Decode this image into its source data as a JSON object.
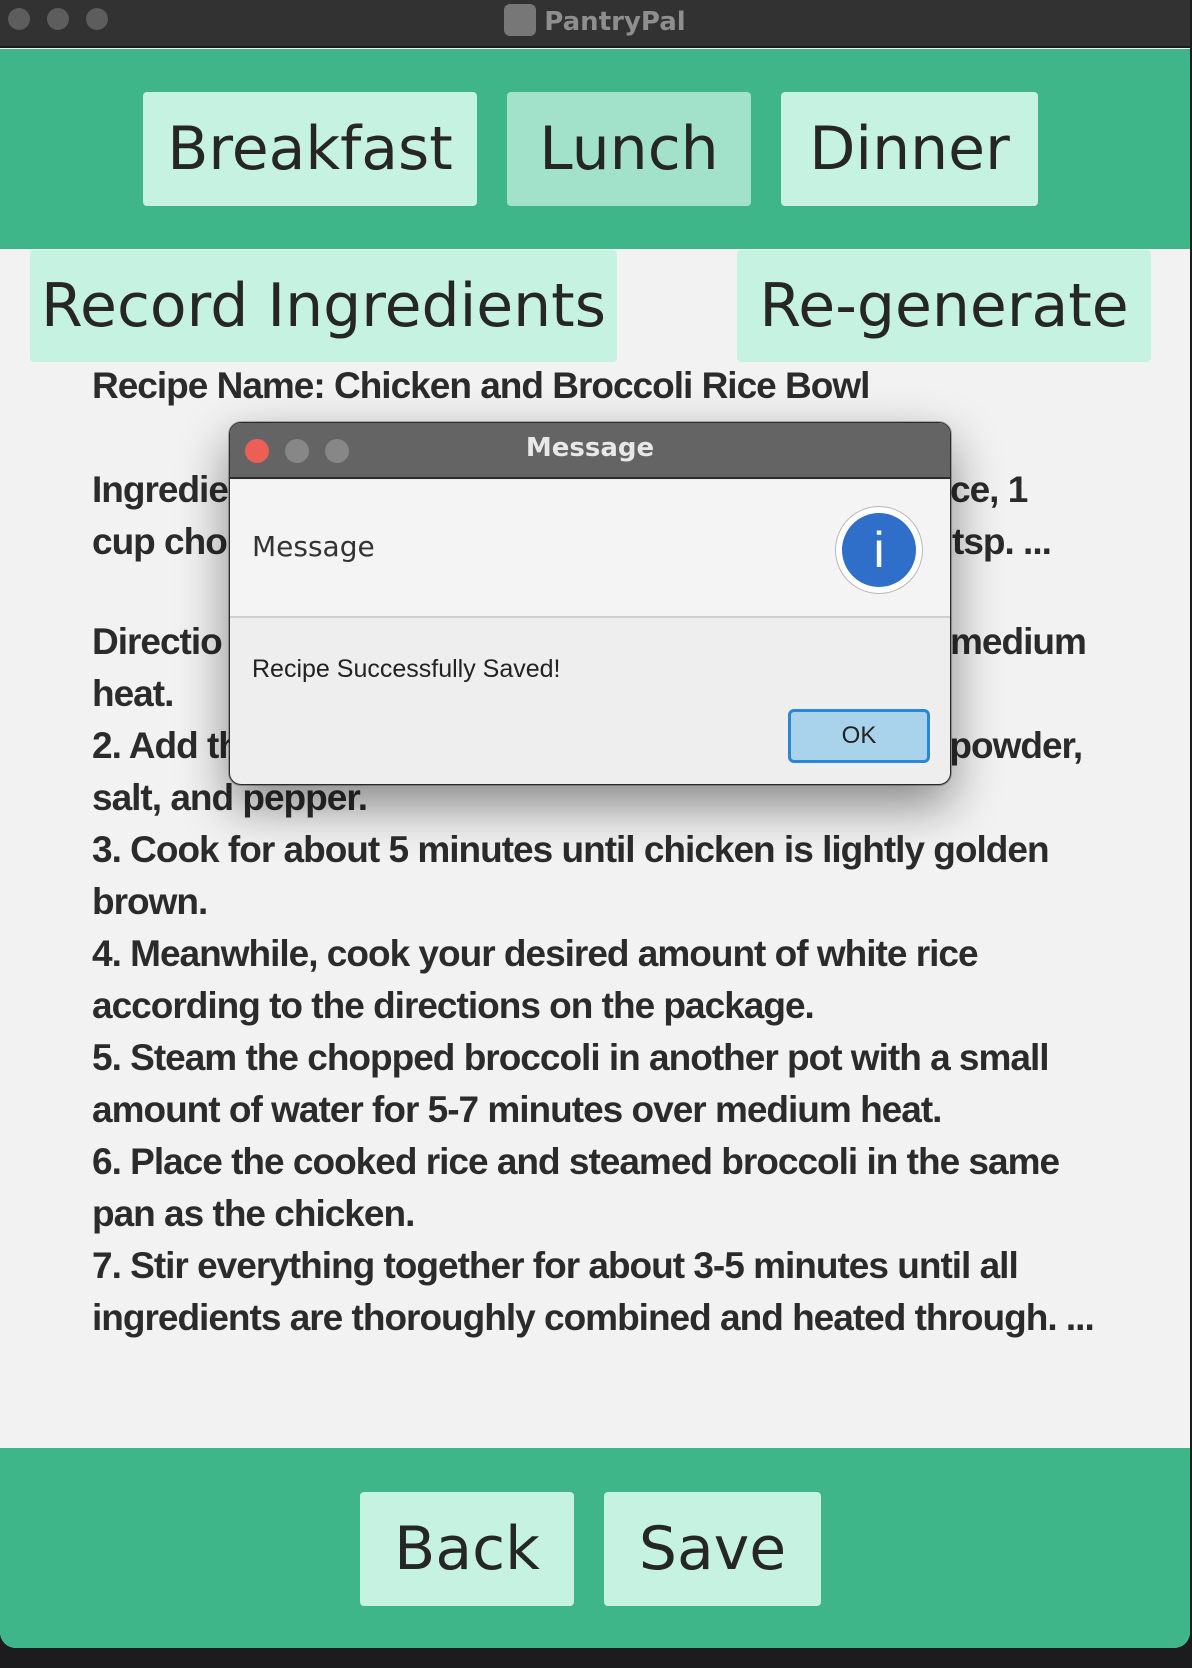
{
  "window": {
    "title": "PantryPal"
  },
  "meal_tabs": [
    {
      "label": "Breakfast"
    },
    {
      "label": "Lunch",
      "selected": true
    },
    {
      "label": "Dinner"
    }
  ],
  "actions": {
    "record_label": "Record Ingredients",
    "regenerate_label": "Re-generate"
  },
  "recipe": {
    "name_line": "Recipe Name: Chicken and Broccoli Rice Bowl",
    "ingredients_line1_left": "Ingredie",
    "ingredients_line1_right": "ce, 1",
    "ingredients_line2_left": "cup chop",
    "ingredients_line2_right": "tsp. ...",
    "directions_line1_left": "Directio",
    "directions_line1_right": "medium",
    "directions_rest": "heat.\n2. Add the chopped chicken and season with garlic powder, salt, and pepper.\n3. Cook for about 5 minutes until chicken is lightly golden brown.\n4. Meanwhile, cook your desired amount of white rice according to the directions on the package.\n5. Steam the chopped broccoli in another pot with a small amount of water for 5-7 minutes over medium heat.\n6. Place the cooked rice and steamed broccoli in the same pan as the chicken.\n7. Stir everything together for about 3-5 minutes until all ingredients are thoroughly combined and heated through. ..."
  },
  "bottom": {
    "back_label": "Back",
    "save_label": "Save"
  },
  "dialog": {
    "title": "Message",
    "header": "Message",
    "icon": "info-icon",
    "icon_glyph": "i",
    "content": "Recipe Successfully Saved!",
    "ok_label": "OK"
  },
  "colors": {
    "accent": "#3fb68a",
    "button": "#c6f3e1",
    "button_selected": "#a2e2cb",
    "close_red": "#ec5f56",
    "info_blue": "#2f6ec9"
  }
}
